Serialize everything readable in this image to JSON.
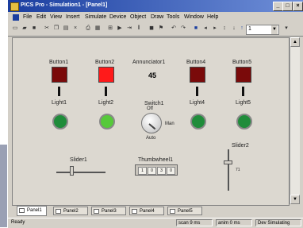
{
  "window": {
    "title": "PICS Pro - Simulation1 - [Panel1]",
    "controls": [
      "_",
      "□",
      "×"
    ]
  },
  "menu": {
    "items": [
      "File",
      "Edit",
      "View",
      "Insert",
      "Simulate",
      "Device",
      "Object",
      "Draw",
      "Tools",
      "Window",
      "Help"
    ]
  },
  "toolbar": {
    "zoom_value": "1",
    "icons": [
      "new-icon",
      "open-icon",
      "save-icon",
      "cut-icon",
      "copy-icon",
      "paste-icon",
      "delete-icon",
      "print-icon",
      "grid-icon",
      "align-icon",
      "play-icon",
      "step-icon",
      "pause-icon",
      "stop-icon",
      "run-icon",
      "back-icon",
      "forward-icon",
      "up-icon",
      "down-icon"
    ]
  },
  "panel": {
    "buttons": [
      {
        "label": "Button1",
        "color": "#7a0a0a"
      },
      {
        "label": "Button2",
        "color": "#ff1a1a"
      },
      {
        "label": "Button4",
        "color": "#7a0a0a"
      },
      {
        "label": "Button5",
        "color": "#7a0a0a"
      }
    ],
    "annunciator": {
      "label": "Annunciator1",
      "value": "45"
    },
    "lights": [
      {
        "label": "Light1",
        "color": "#1f8c3a"
      },
      {
        "label": "Light2",
        "color": "#56c93a"
      },
      {
        "label": "Light4",
        "color": "#1f8c3a"
      },
      {
        "label": "Light5",
        "color": "#1f8c3a"
      }
    ],
    "switch": {
      "label": "Switch1",
      "pos_off": "Off",
      "pos_man": "Man",
      "pos_auto": "Auto"
    },
    "slider1": {
      "label": "Slider1",
      "level": 0.3
    },
    "thumbwheel": {
      "label": "Thumbwheel1",
      "digits": [
        "1",
        "0",
        "3",
        "0"
      ]
    },
    "slider2": {
      "label": "Slider2",
      "value_label": "71",
      "level": 0.7
    }
  },
  "tabs": [
    "Panel1",
    "Panel2",
    "Panel3",
    "Panel4",
    "Panel5"
  ],
  "status": {
    "ready": "Ready",
    "scan": "scan  9 ms",
    "anim": "anim  0 ms",
    "mode": "Dev  Simulating"
  }
}
